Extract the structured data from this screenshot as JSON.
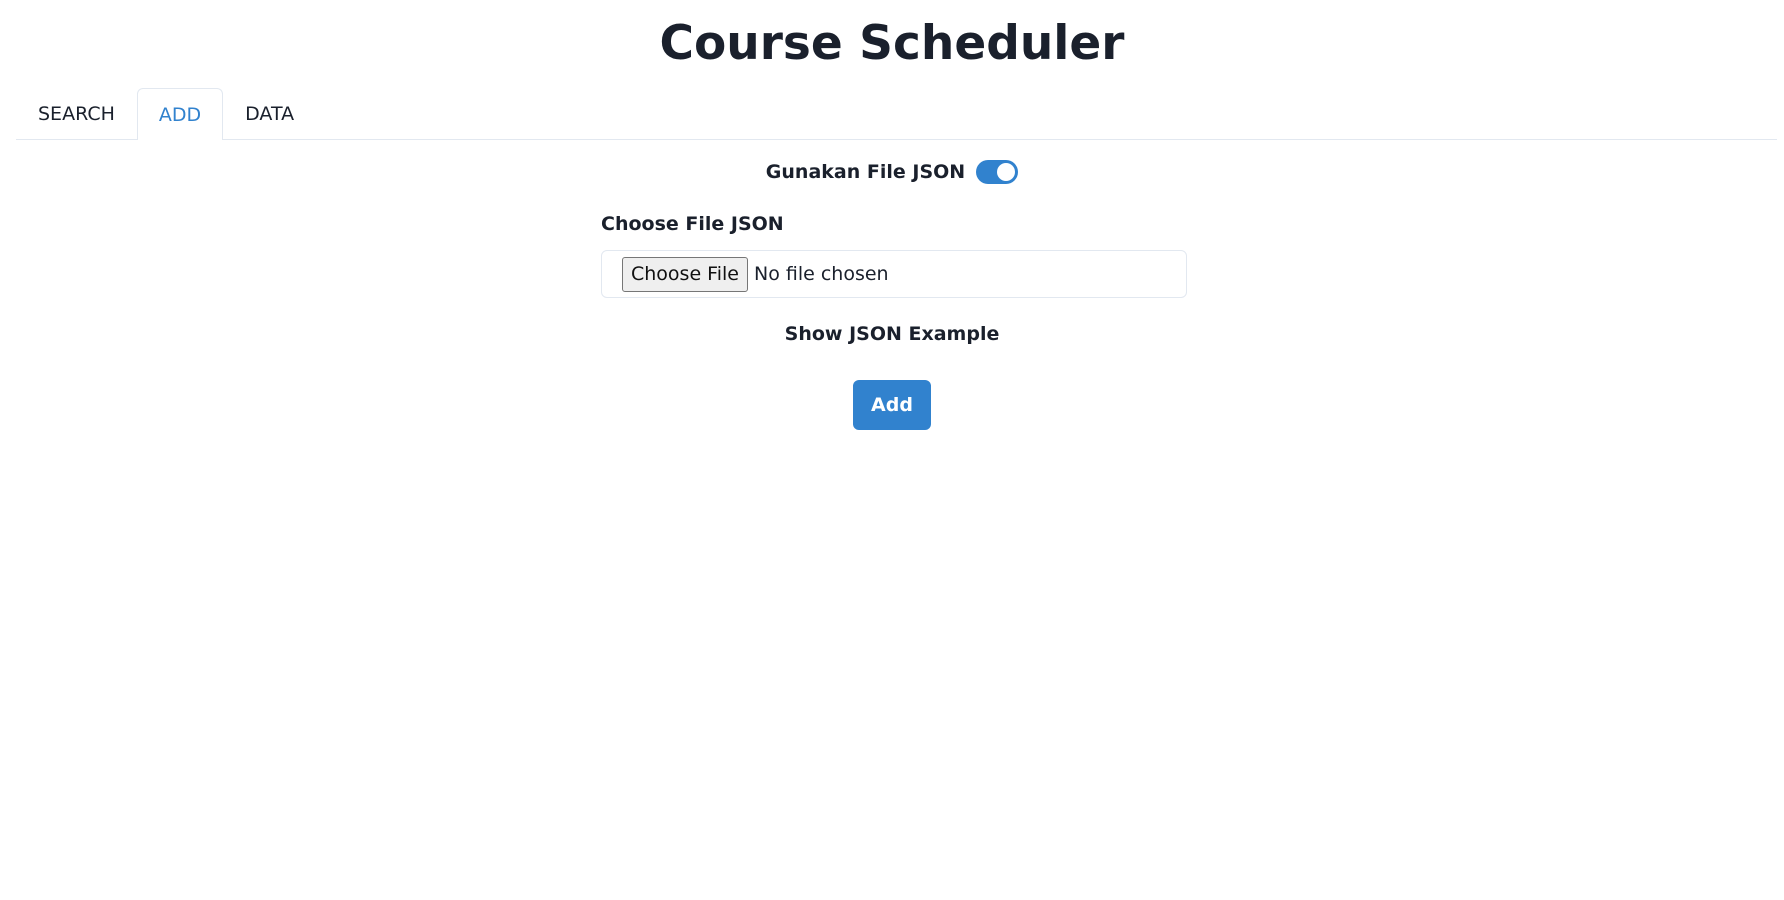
{
  "header": {
    "title": "Course Scheduler"
  },
  "tabs": [
    {
      "label": "SEARCH",
      "active": false
    },
    {
      "label": "ADD",
      "active": true
    },
    {
      "label": "DATA",
      "active": false
    }
  ],
  "form": {
    "toggle_label": "Gunakan File JSON",
    "toggle_on": true,
    "file_label": "Choose File JSON",
    "file_button_label": "Choose File",
    "file_status": "No file chosen",
    "example_label": "Show JSON Example",
    "submit_label": "Add"
  },
  "colors": {
    "accent": "#3182ce",
    "text": "#1a202c",
    "border": "#e2e8f0"
  }
}
